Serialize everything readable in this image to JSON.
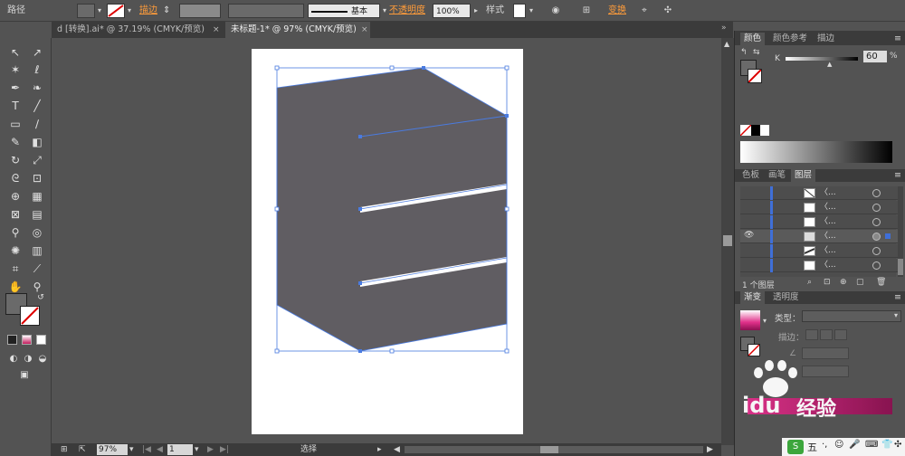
{
  "control_bar": {
    "path_label": "路径",
    "stroke_label": "描边",
    "stroke_style": "基本",
    "opacity_label": "不透明度",
    "opacity_value": "100%",
    "style_label": "样式",
    "transform_label": "变换"
  },
  "tabs": [
    {
      "label": "d [转换].ai* @ 37.19% (CMYK/预览)",
      "active": false
    },
    {
      "label": "未标题-1* @ 97% (CMYK/预览)",
      "active": true
    }
  ],
  "status": {
    "zoom": "97%",
    "page": "1",
    "tool_name": "选择"
  },
  "color_panel": {
    "tabs": [
      "颜色",
      "颜色参考",
      "描边"
    ],
    "channel": "K",
    "value": "60",
    "unit": "%"
  },
  "layers_panel": {
    "tabs": [
      "色板",
      "画笔",
      "图层"
    ],
    "rows": [
      "〈...",
      "〈...",
      "〈...",
      "〈...",
      "〈...",
      "〈..."
    ],
    "footer": "1 个图层"
  },
  "gradient_panel": {
    "tabs": [
      "渐变",
      "透明度"
    ],
    "type_label": "类型：",
    "stroke_label": "描边："
  },
  "watermark": {
    "brand": "Baidu",
    "text": "经验"
  },
  "colors": {
    "ui_dark": "#535353",
    "shape_fill": "#605d62",
    "selection": "#4a7be0",
    "gradient_pink": "#e0308a"
  }
}
